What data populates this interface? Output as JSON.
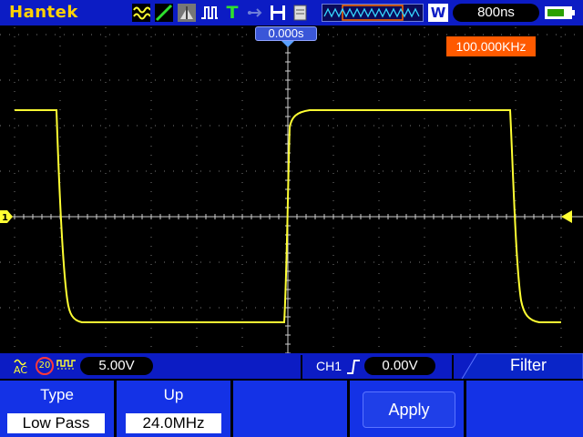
{
  "top_bar": {
    "brand": "Hantek",
    "trigger_status": "T",
    "acquire_mode": "W",
    "timebase": "800ns",
    "icons": [
      "waveform-ac-icon",
      "display-vector-icon",
      "cursor-icon",
      "pulse-icon",
      "trigger-status-icon",
      "usb-icon",
      "save-icon",
      "document-icon",
      "memory-waveform-icon",
      "battery-icon"
    ]
  },
  "display": {
    "trigger_time_offset": "0.000s",
    "frequency_readout": "100.000KHz",
    "channel1_marker": "1"
  },
  "status_bar": {
    "coupling": "AC",
    "bandwidth_limit": "20",
    "ch1_scale": "5.00V",
    "trigger_source": "CH1",
    "trigger_level": "0.00V"
  },
  "menu": {
    "title": "Filter",
    "softkeys": [
      {
        "label": "Type",
        "value": "Low Pass"
      },
      {
        "label": "Up",
        "value": "24.0MHz"
      },
      {
        "label": "",
        "value": ""
      },
      {
        "label": "Apply",
        "value": ""
      },
      {
        "label": "",
        "value": ""
      }
    ]
  },
  "colors": {
    "ui_blue": "#0c1cc4",
    "softkey_blue": "#1432e6",
    "trace_yellow": "#ffff33",
    "brand_yellow": "#ffd200",
    "freq_orange": "#ff5a00",
    "grid_dot": "#8a8a8a"
  }
}
